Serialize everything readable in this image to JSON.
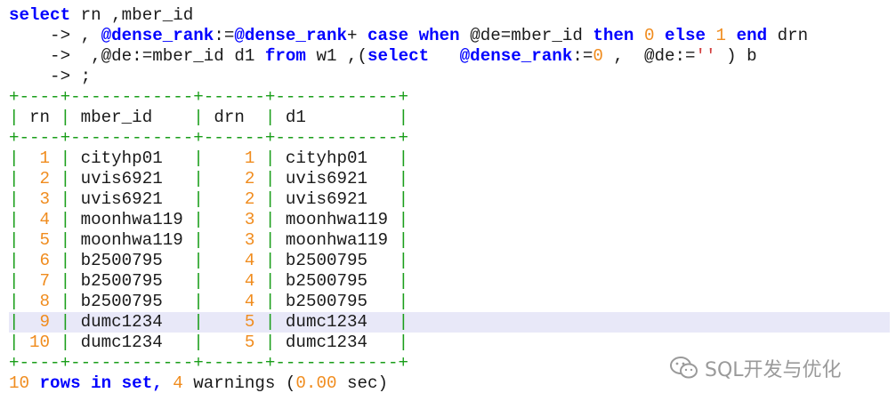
{
  "sql": {
    "line1": {
      "select_kw": "select",
      "rest": " rn ,mber_id"
    },
    "line2": {
      "prompt": "    -> ",
      "part1": ", ",
      "var1": "@dense_rank",
      "assign": ":=",
      "var2": "@dense_rank",
      "plus": "+ ",
      "case_kw": "case",
      "sp1": " ",
      "when_kw": "when",
      "cond": " @de=mber_id ",
      "then_kw": "then",
      "zero": " 0 ",
      "else_kw": "else",
      "one": " 1 ",
      "end_kw": "end",
      "alias": " drn"
    },
    "line3": {
      "prompt": "    -> ",
      "part1": " ,@de:=mber_id d1 ",
      "from_kw": "from",
      "part2": " w1 ,(",
      "select_kw": "select",
      "part3": "   ",
      "var1": "@dense_rank",
      "assign": ":=",
      "zero": "0",
      "part4": " ,  @de:=",
      "str": "''",
      "part5": " ) b"
    },
    "line4": {
      "prompt": "    -> ",
      "end": ";"
    }
  },
  "result_table": {
    "border": "+----+------------+------+------------+",
    "headers": [
      "rn",
      "mber_id",
      "drn",
      "d1"
    ],
    "rows": [
      {
        "rn": "1",
        "mber_id": "cityhp01",
        "drn": "1",
        "d1": "cityhp01"
      },
      {
        "rn": "2",
        "mber_id": "uvis6921",
        "drn": "2",
        "d1": "uvis6921"
      },
      {
        "rn": "3",
        "mber_id": "uvis6921",
        "drn": "2",
        "d1": "uvis6921"
      },
      {
        "rn": "4",
        "mber_id": "moonhwa119",
        "drn": "3",
        "d1": "moonhwa119"
      },
      {
        "rn": "5",
        "mber_id": "moonhwa119",
        "drn": "3",
        "d1": "moonhwa119"
      },
      {
        "rn": "6",
        "mber_id": "b2500795",
        "drn": "4",
        "d1": "b2500795"
      },
      {
        "rn": "7",
        "mber_id": "b2500795",
        "drn": "4",
        "d1": "b2500795"
      },
      {
        "rn": "8",
        "mber_id": "b2500795",
        "drn": "4",
        "d1": "b2500795"
      },
      {
        "rn": "9",
        "mber_id": "dumc1234",
        "drn": "5",
        "d1": "dumc1234"
      },
      {
        "rn": "10",
        "mber_id": "dumc1234",
        "drn": "5",
        "d1": "dumc1234"
      }
    ],
    "highlighted_row_index": 8
  },
  "status": {
    "count": "10",
    "rows_in_set": " rows in set, ",
    "warnings_count": "4",
    "warnings": " warnings (",
    "time": "0.00",
    "sec": " sec)"
  },
  "watermark": {
    "text": "SQL开发与优化",
    "icon": "wechat-icon"
  },
  "colors": {
    "keyword": "#0000ff",
    "number": "#f08c1e",
    "string": "#d23c3c",
    "border": "#1a9e1a",
    "highlight": "#e8e8f8",
    "text": "#1a1a1a"
  }
}
